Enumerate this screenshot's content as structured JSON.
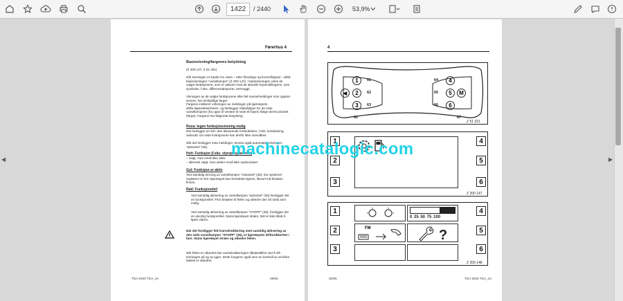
{
  "toolbar": {
    "current_page": "1422",
    "total_pages": "/ 2440",
    "zoom": "53,9%"
  },
  "left_page": {
    "header": "Førerhus 4",
    "title": "Basisvisning/fargenes betydning",
    "ref": "(Z 200 147, Z 51 331)",
    "intro": "Når tenningen er koplet inn vises – etter firmalogo og kontrollsignal – alltid basisvisningen \"varsellamper\" (Z 200 147). I basisvisningen vises de valgte funksjonene, som er aktivert med de aktuelle bryterstillingene, som symboler, f.eks. differensialsperrer, terrenggir.",
    "intro2": "Visningen av de valgte funksjonene eller feil-/varselmeldinger som opptrer senere, har forskjellige farger.",
    "intro3": "Fargene indikerer virkningen av meldingen på kjøretøyets drifts-/kjøresikkerheten, og fastlegger rekkefølgen for de viste varsellampene (fra oppe til venstre til nede til høyre) ifølge deres prioritet (farge). Fargene har følgende betydning:",
    "s1_title": "Rosa: legen funksjonsvisning mulig",
    "s1_text": "Det foreligger en feil i den tilsvarende forbindelsen, f.eks. kortslutning, avbrudd. De viste funksjonene kan derfor ikke overvåkes.",
    "s1_text2": "Når det foreligger rosa meldinger, tennes også automatisk visningen \"advarsel\" (36).",
    "s2_title": "Hvit: Funksjon (f.eks. styreprogrammer)",
    "s2_line1": "– valgt, men ennå ikke aktiv",
    "s2_line2": "– allerede valgt, men aksler ennå ikke synkronisert",
    "s3_title": "Gul: Funksjon er aktiv",
    "s3_text": "Ved samtidig tenning av varsellampen \"Advarsel\" (36), har systemet registrert en feil. Kjøretøyet kan fremdeles kjøres, likevel må årsaken finnes.",
    "s4_title": "Rød: Funksjonsfeil",
    "s4_b1": "Ved samtidig aktivering av varsellampen \"advarsel\" (36) foreligger det en funksjonsfeil. Finn årsaken til feilen og utbedre den så raskt som mulig.",
    "s4_b2": "Ved samtidig aktivering av varsellampen \"STOPP\" (35), foreligger det en alvorlig funksjonsfeil. Stans kjøretøyet straks. Det er ikke tillatt å kjøre videre.",
    "warn_text": "Når det foreligger feil-/varselindikering med samtidig aktivering av den røde varsellampen \"STOPP\" (35), er kjøretøyets driftssikkerhet i fare. Stans kjøretøyet straks og utbedre feilen.",
    "end_text": "Når feilen er utbedret kan varselindikeringen tilbakestilles ved å slå tenningen på og av igjen. Dette fungerer også som en kontroll av at feilen faktisk er utbedret.",
    "foot_left": "TGA 2040 TGA_no",
    "foot_right": "29/55"
  },
  "right_page": {
    "header": "4",
    "fig1_caption": "Z 51 321",
    "fig1_labels": [
      "61",
      "62",
      "63",
      "60",
      "64",
      "65",
      "66",
      "67"
    ],
    "fig1_buttons": [
      "1",
      "2",
      "3",
      "4",
      "5",
      "6"
    ],
    "fig1_mode": "M",
    "fig2_caption": "Z 200 147",
    "fig3_caption": "Z 200 148",
    "boxes": [
      "1",
      "2",
      "3",
      "4",
      "5",
      "6"
    ],
    "gauge_ticks": "0 25 50 75 100",
    "fm_label": "FM",
    "foot_left": "30/55",
    "foot_right": "TGA 2040 TGA_no"
  },
  "watermark": "machinecatalogic.com"
}
